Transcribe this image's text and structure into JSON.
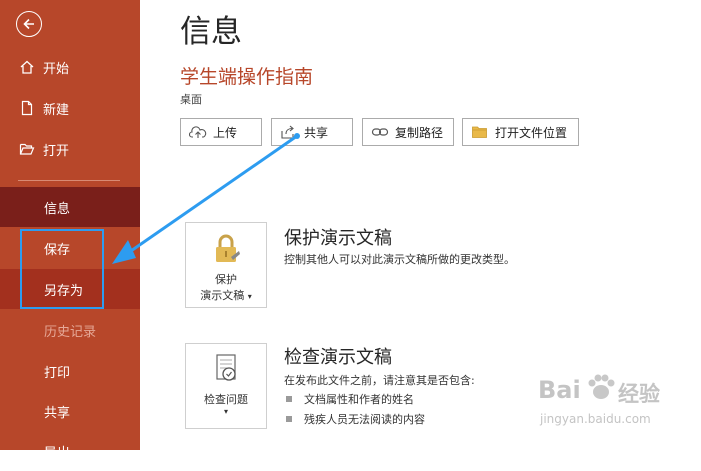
{
  "sidebar": {
    "back_label": "",
    "items": [
      {
        "label": "开始"
      },
      {
        "label": "新建"
      },
      {
        "label": "打开"
      },
      {
        "label": "信息"
      },
      {
        "label": "保存"
      },
      {
        "label": "另存为"
      },
      {
        "label": "历史记录"
      },
      {
        "label": "打印"
      },
      {
        "label": "共享"
      },
      {
        "label": "导出"
      }
    ]
  },
  "header": {
    "page_title": "信息",
    "document_title": "学生端操作指南",
    "document_location": "桌面"
  },
  "toolbar": {
    "upload_label": "上传",
    "share_label": "共享",
    "copy_path_label": "复制路径",
    "open_location_label": "打开文件位置"
  },
  "protect": {
    "card_line1": "保护",
    "card_line2": "演示文稿",
    "heading": "保护演示文稿",
    "description": "控制其他人可以对此演示文稿所做的更改类型。"
  },
  "inspect": {
    "card_label": "检查问题",
    "heading": "检查演示文稿",
    "description": "在发布此文件之前，请注意其是否包含:",
    "bullets": [
      "文档属性和作者的姓名",
      "残疾人员无法阅读的内容"
    ]
  },
  "watermark": {
    "line1": "Bai",
    "line2": "经验",
    "line3": "jingyan.baidu.com"
  },
  "colors": {
    "sidebar": "#b7472a",
    "sidebar_selected": "#7a1f1a",
    "accent_title": "#b7472a",
    "annotation": "#2d9cf0"
  }
}
